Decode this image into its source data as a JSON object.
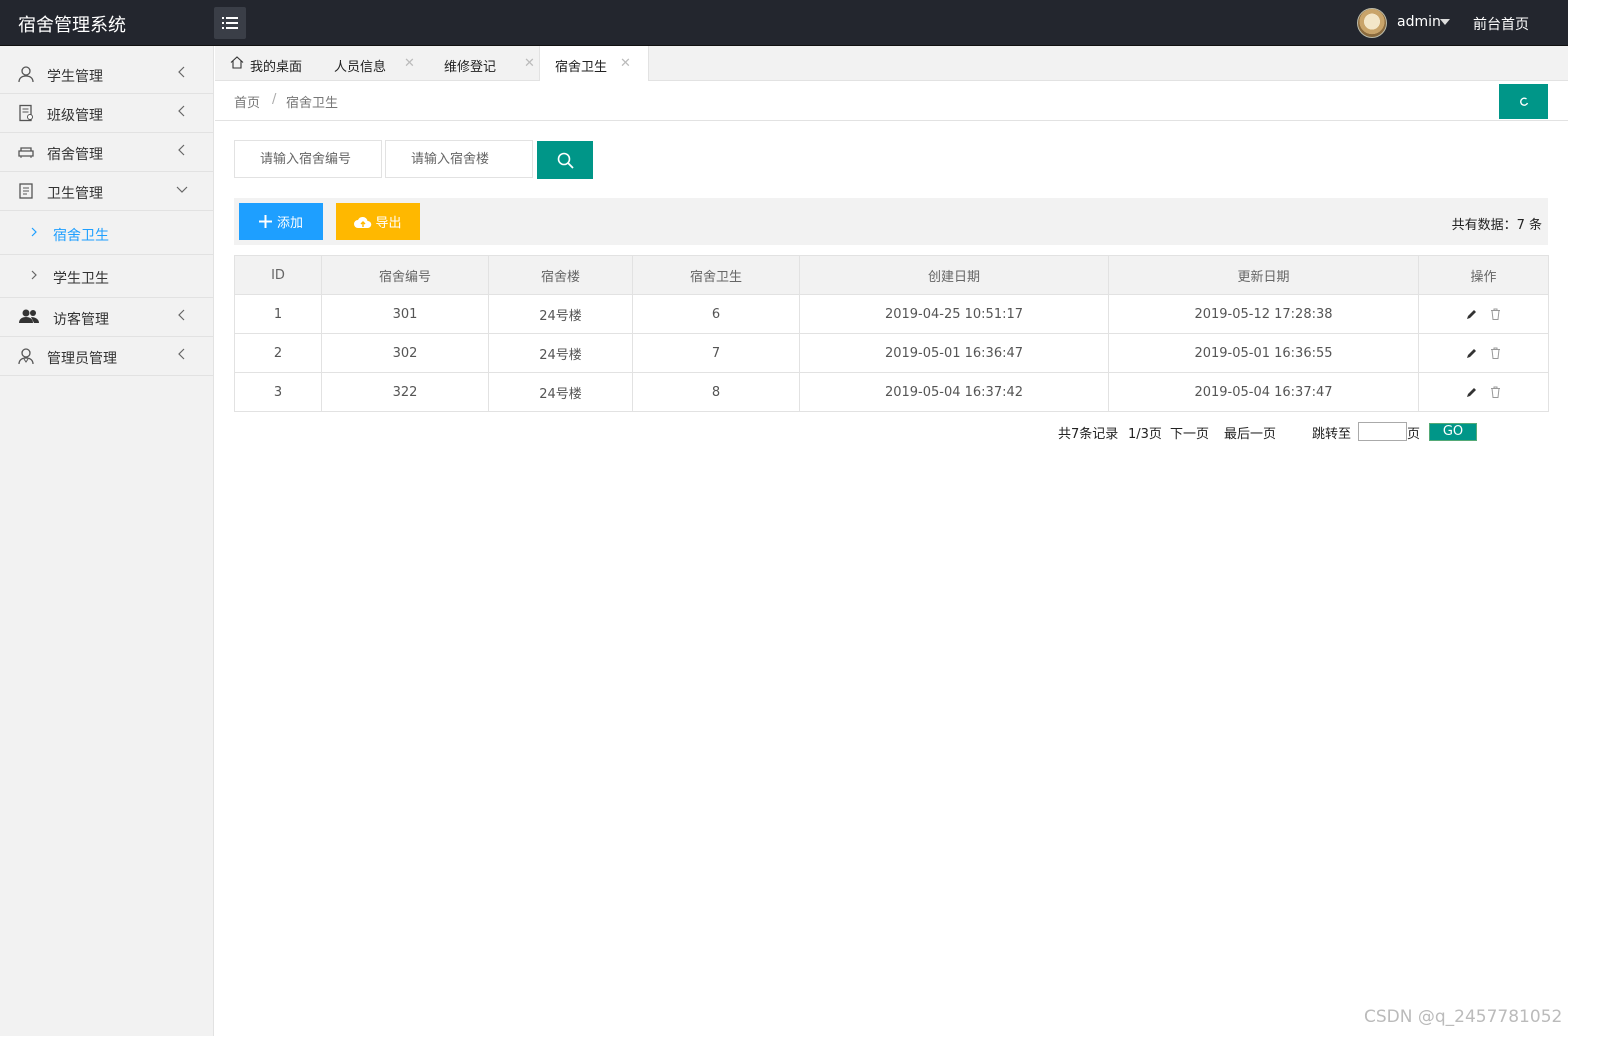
{
  "app": {
    "title": "宿舍管理系统"
  },
  "header": {
    "user": "admin",
    "front_link": "前台首页"
  },
  "sidebar": {
    "items": [
      {
        "label": "学生管理"
      },
      {
        "label": "班级管理"
      },
      {
        "label": "宿舍管理"
      },
      {
        "label": "卫生管理"
      },
      {
        "label": "访客管理"
      },
      {
        "label": "管理员管理"
      }
    ],
    "sub_items": [
      {
        "label": "宿舍卫生"
      },
      {
        "label": "学生卫生"
      }
    ]
  },
  "tabs": [
    {
      "label": "我的桌面"
    },
    {
      "label": "人员信息"
    },
    {
      "label": "维修登记"
    },
    {
      "label": "宿舍卫生"
    }
  ],
  "tab_close_glyph": "✕",
  "breadcrumb": {
    "home": "首页",
    "separator": "/",
    "current": "宿舍卫生"
  },
  "search": {
    "dorm_no_placeholder": "请输入宿舍编号",
    "building_placeholder": "请输入宿舍楼"
  },
  "toolbar": {
    "add_label": "添加",
    "export_label": "导出",
    "total": "共有数据：7 条"
  },
  "table": {
    "headers": [
      "ID",
      "宿舍编号",
      "宿舍楼",
      "宿舍卫生",
      "创建日期",
      "更新日期",
      "操作"
    ],
    "rows": [
      [
        "1",
        "301",
        "24号楼",
        "6",
        "2019-04-25 10:51:17",
        "2019-05-12 17:28:38"
      ],
      [
        "2",
        "302",
        "24号楼",
        "7",
        "2019-05-01 16:36:47",
        "2019-05-01 16:36:55"
      ],
      [
        "3",
        "322",
        "24号楼",
        "8",
        "2019-05-04 16:37:42",
        "2019-05-04 16:37:47"
      ]
    ]
  },
  "pager": {
    "records": "共7条记录",
    "pages": "1/3页",
    "next": "下一页",
    "last": "最后一页",
    "jump_to": "跳转至",
    "page_unit": "页",
    "go": "GO"
  },
  "watermark": "CSDN @q_2457781052",
  "colors": {
    "accent": "#009688",
    "add": "#1e9fff",
    "export": "#ffb800",
    "topbar": "#23262e",
    "sub_active": "#1e9fff"
  }
}
